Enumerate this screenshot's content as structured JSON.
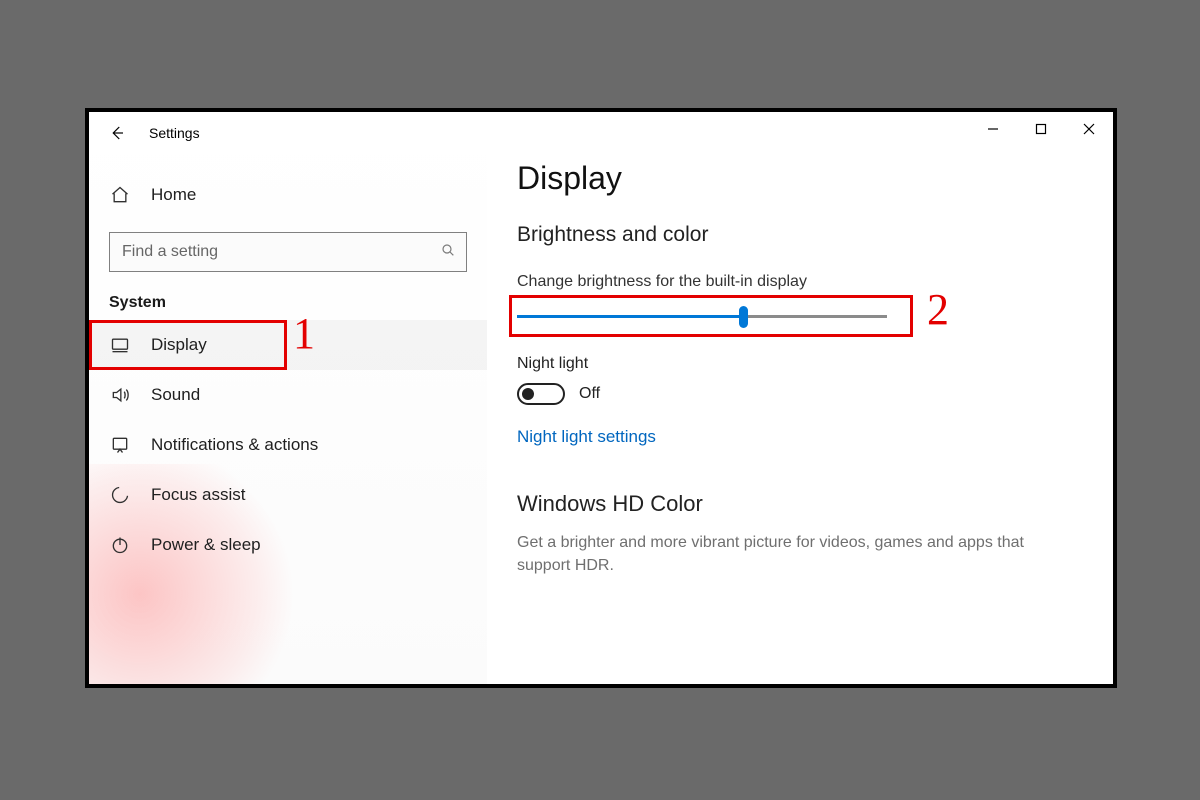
{
  "window": {
    "title": "Settings"
  },
  "sidebar": {
    "home_label": "Home",
    "search_placeholder": "Find a setting",
    "category": "System",
    "items": [
      {
        "label": "Display"
      },
      {
        "label": "Sound"
      },
      {
        "label": "Notifications & actions"
      },
      {
        "label": "Focus assist"
      },
      {
        "label": "Power & sleep"
      }
    ]
  },
  "main": {
    "page_title": "Display",
    "brightness_section": "Brightness and color",
    "brightness_label": "Change brightness for the built-in display",
    "brightness_value_percent": 61,
    "night_light_label": "Night light",
    "night_light_state": "Off",
    "night_light_link": "Night light settings",
    "hd_section": "Windows HD Color",
    "hd_description": "Get a brighter and more vibrant picture for videos, games and apps that support HDR."
  },
  "annotations": {
    "one": "1",
    "two": "2"
  }
}
